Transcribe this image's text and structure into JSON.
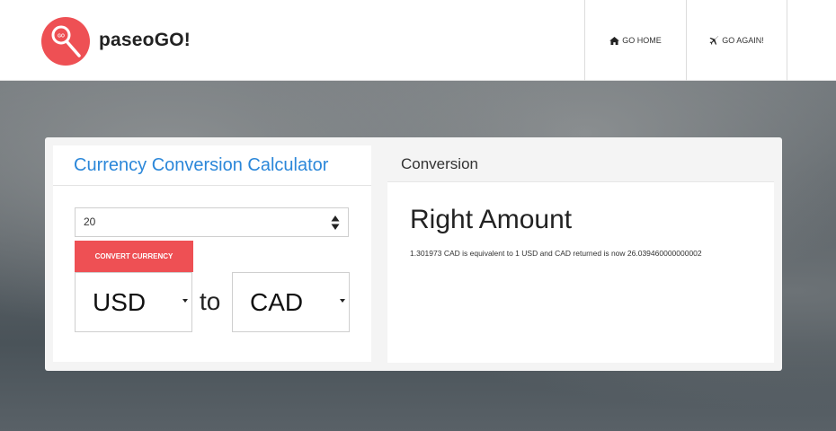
{
  "app": {
    "brand": "paseoGO!",
    "logo_icon": "magnifier-logo-icon",
    "logo_color": "#ee5054"
  },
  "nav": {
    "home_label": "GO HOME",
    "home_icon": "home-icon",
    "again_label": "GO AGAIN!",
    "again_icon": "airplane-icon"
  },
  "calculator": {
    "title": "Currency Conversion Calculator",
    "amount_value": "20",
    "convert_label": "CONVERT CURRENCY",
    "from_currency": "USD",
    "to_word": "to",
    "to_currency": "CAD",
    "accent_color": "#2b87d9",
    "button_color": "#ee5054"
  },
  "conversion": {
    "header": "Conversion",
    "result_title": "Right Amount",
    "result_text": "1.301973 CAD is equivalent to 1 USD and CAD returned is now 26.039460000000002"
  }
}
